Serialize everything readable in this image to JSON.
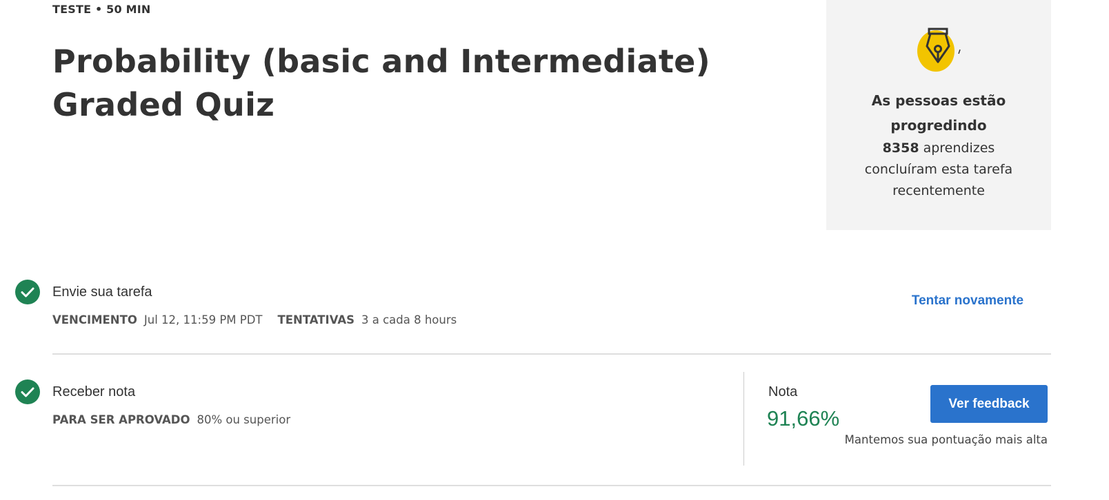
{
  "header": {
    "meta": "TESTE • 50 MIN",
    "title": "Probability (basic and Intermediate) Graded Quiz"
  },
  "progress_card": {
    "icon": "trophy-pen-icon",
    "heading_line1": "As pessoas estão",
    "heading_line2": "progredindo",
    "count": "8358",
    "text_after_count": " aprendizes",
    "line2": "concluíram esta tarefa",
    "line3": "recentemente",
    "accent_color": "#f2c400"
  },
  "submit_step": {
    "title": "Envie sua tarefa",
    "due_label": "VENCIMENTO",
    "due_value": "Jul 12, 11:59 PM PDT",
    "attempts_label": "TENTATIVAS",
    "attempts_value": "3 a cada 8 hours",
    "retry_label": "Tentar novamente"
  },
  "grade_step": {
    "title": "Receber nota",
    "pass_label": "PARA SER APROVADO",
    "pass_value": "80% ou superior",
    "grade_label": "Nota",
    "grade_value": "91,66%",
    "feedback_button": "Ver feedback",
    "highest_note": "Mantemos sua pontuação mais alta"
  },
  "colors": {
    "success": "#1f8354",
    "link": "#2a73cc",
    "card_bg": "#f3f3f3"
  }
}
